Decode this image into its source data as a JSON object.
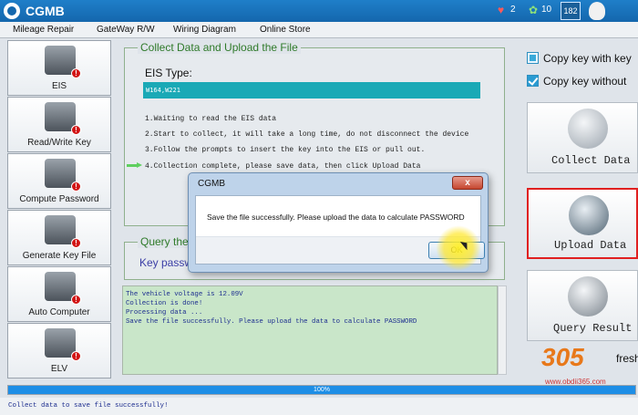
{
  "app": {
    "title": "CGMB",
    "hearts": "2",
    "points": "10",
    "badge": "182"
  },
  "menu": [
    "Mileage Repair",
    "GateWay R/W",
    "Wiring Diagram",
    "Online Store"
  ],
  "sidebar": {
    "items": [
      {
        "label": "EIS",
        "icon": "ignition-key-icon"
      },
      {
        "label": "Read/Write Key",
        "icon": "car-key-icon"
      },
      {
        "label": "Compute Password",
        "icon": "computer-icon"
      },
      {
        "label": "Generate Key File",
        "icon": "key-file-icon"
      },
      {
        "label": "Auto Computer",
        "icon": "ecu-icon"
      },
      {
        "label": "ELV",
        "icon": "steering-lock-icon"
      }
    ],
    "alert_badge": "!"
  },
  "collect": {
    "title": "Collect Data and Upload the File",
    "eis_label": "EIS Type:",
    "eis_value": "W164,W221",
    "steps": [
      "1.Waiting to read the EIS data",
      "2.Start to collect, it will take a long time, do not disconnect the device",
      "3.Follow the prompts to insert the key into the EIS or pull out.",
      "4.Collection complete, please save data, then click Upload Data"
    ]
  },
  "query": {
    "title": "Query the",
    "key_password_label": "Key passw"
  },
  "log": {
    "lines": [
      "The vehicle voltage is 12.09V",
      "Collection is done!",
      "Processing data ...",
      "Save the file successfully. Please upload the data to calculate PASSWORD"
    ]
  },
  "right": {
    "copy_key_with": "Copy key with key",
    "copy_key_without": "Copy key without",
    "collect_data": "Collect Data",
    "upload_data": "Upload Data",
    "query_result": "Query Result",
    "refresh": "fresh"
  },
  "watermark": {
    "number": "305",
    "url": "www.obdii365.com"
  },
  "progress": {
    "text": "100%",
    "value": 1.0
  },
  "status": "Collect data to save file successfully!",
  "dialog": {
    "title": "CGMB",
    "message": "Save the file successfully. Please upload the data to calculate PASSWORD",
    "ok": "OK",
    "close": "x"
  }
}
